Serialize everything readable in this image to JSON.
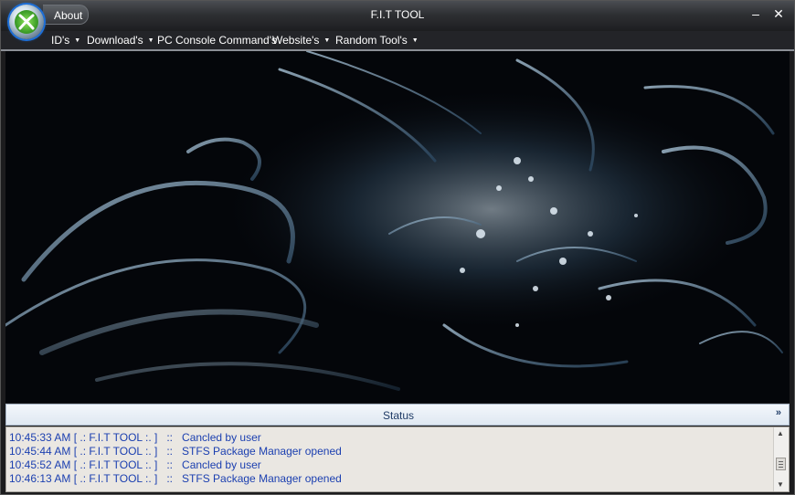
{
  "window": {
    "title": "F.I.T TOOL",
    "about_label": "About",
    "minimize_label": "–",
    "close_label": "✕"
  },
  "menu": [
    {
      "label": "ID's"
    },
    {
      "label": "Download's"
    },
    {
      "label": "PC Console Command's"
    },
    {
      "label": "Website's"
    },
    {
      "label": "Random Tool's"
    }
  ],
  "menu_arrow": "▼",
  "status": {
    "label": "Status",
    "collapse": "»"
  },
  "log": [
    {
      "time": "10:45:33 AM",
      "source": "[ .: F.I.T TOOL :. ]",
      "sep": "::",
      "message": "Cancled by user"
    },
    {
      "time": "10:45:44 AM",
      "source": "[ .: F.I.T TOOL :. ]",
      "sep": "::",
      "message": "STFS Package Manager opened"
    },
    {
      "time": "10:45:52 AM",
      "source": "[ .: F.I.T TOOL :. ]",
      "sep": "::",
      "message": "Cancled by user"
    },
    {
      "time": "10:46:13 AM",
      "source": "[ .: F.I.T TOOL :. ]",
      "sep": "::",
      "message": "STFS Package Manager opened"
    }
  ],
  "icons": {
    "orb": "xbox-orb-icon",
    "scroll_up": "▲",
    "scroll_down": "▼"
  },
  "colors": {
    "accent": "#1d6fd8",
    "log_text": "#1b3fb0",
    "status_text": "#1f3b66"
  }
}
